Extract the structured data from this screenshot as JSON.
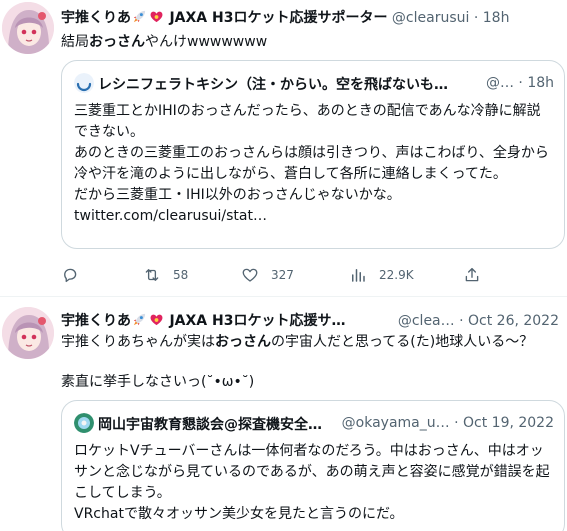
{
  "tweet1": {
    "author_name": "宇推くりあ",
    "author_name_suffix": "JAXA H3ロケット応援サポーター",
    "handle": "@clearusui",
    "separator": "·",
    "time": "18h",
    "text_pre": "結局",
    "text_bold": "おっさん",
    "text_post": "やんけwwwwwww",
    "quote": {
      "author_name": "レシニフェラトキシン（注・からい。空を飛ばないも…",
      "handle": "@…",
      "separator": "·",
      "time": "18h",
      "text": "三菱重工とかIHIのおっさんだったら、あのときの配信であんな冷静に解説できない。\nあのときの三菱重工のおっさんらは顔は引きつり、声はこわばり、全身から冷や汗を滝のように出しながら、蒼白して各所に連絡しまくってた。\nだから三菱重工・IHI以外のおっさんじゃないかな。\ntwitter.com/clearusui/stat…"
    },
    "actions": {
      "reply_count": "",
      "retweet_count": "58",
      "like_count": "327",
      "views_count": "22.9K"
    }
  },
  "tweet2": {
    "author_name": "宇推くりあ",
    "author_name_suffix": "JAXA H3ロケット応援サ…",
    "handle": "@clea…",
    "separator": "·",
    "time": "Oct 26, 2022",
    "text_pre": "宇推くりあちゃんが実は",
    "text_bold": "おっさん",
    "text_post": "の宇宙人だと思ってる(た)地球人いる～？\n\n素直に挙手しなさいっ(˘•ω•˘)",
    "quote": {
      "author_name": "岡山宇宙教育懇談会@探査機安全…",
      "handle": "@okayama_u…",
      "separator": "·",
      "time": "Oct 19, 2022",
      "text": "ロケットVチューバーさんは一体何者なのだろう。中はおっさん、中はオッサンと念じながら見ているのであるが、あの萌え声と容姿に感覚が錯誤を起こしてしまう。\nVRchatで散々オッサン美少女を見たと言うのにだ。"
    }
  },
  "icons": {
    "reply": "reply-icon",
    "retweet": "retweet-icon",
    "like": "heart-icon",
    "views": "views-chart-icon",
    "share": "share-icon"
  },
  "colors": {
    "text_primary": "#0f1419",
    "text_secondary": "#536471",
    "border": "#cfd9de"
  }
}
